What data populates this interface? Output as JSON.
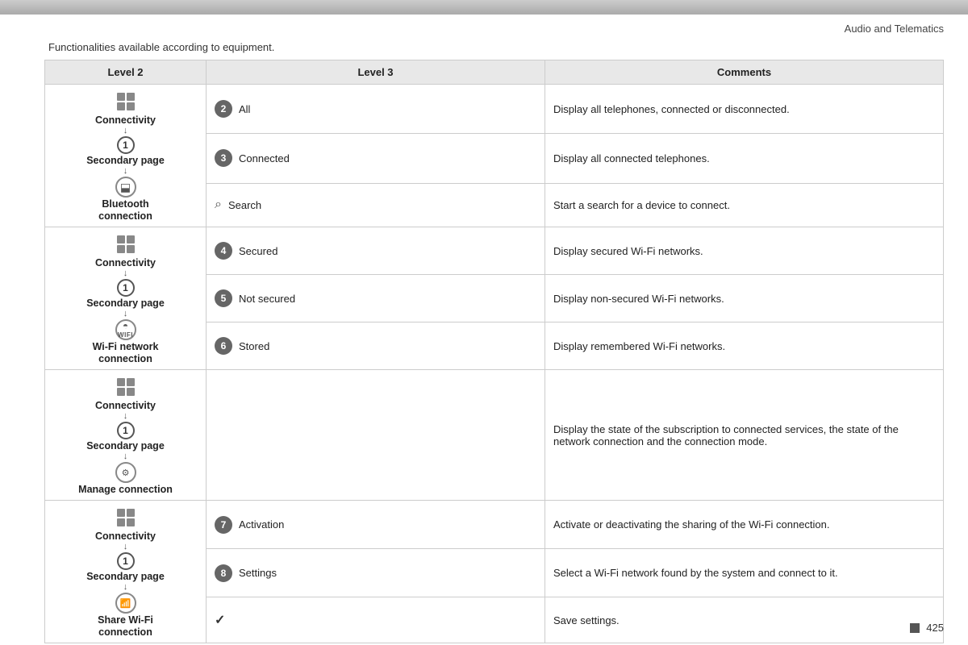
{
  "page": {
    "header": "Audio and Telematics",
    "intro": "Functionalities available according to equipment.",
    "footer_page": "425"
  },
  "table": {
    "headers": [
      "Level 2",
      "Level 3",
      "Comments"
    ],
    "sections": [
      {
        "id": "bluetooth",
        "level2_lines": [
          "Connectivity",
          "↓",
          "Secondary page",
          "↓",
          "Bluetooth",
          "connection"
        ],
        "level2_icon": "grid",
        "level2_badge": "1",
        "level2_sub_icon": "bluetooth",
        "rows": [
          {
            "badge": "2",
            "badge_type": "filled",
            "level3_text": "All",
            "comment": "Display all telephones, connected or disconnected."
          },
          {
            "badge": "3",
            "badge_type": "filled",
            "level3_text": "Connected",
            "comment": "Display all connected telephones."
          },
          {
            "badge": "search",
            "badge_type": "search",
            "level3_text": "Search",
            "comment": "Start a search for a device to connect."
          }
        ]
      },
      {
        "id": "wifi-network",
        "level2_lines": [
          "Connectivity",
          "↓",
          "Secondary page",
          "↓",
          "Wi-Fi network",
          "connection"
        ],
        "level2_icon": "grid",
        "level2_badge": "1",
        "level2_sub_icon": "wifi",
        "rows": [
          {
            "badge": "4",
            "badge_type": "filled",
            "level3_text": "Secured",
            "comment": "Display secured Wi-Fi networks."
          },
          {
            "badge": "5",
            "badge_type": "filled",
            "level3_text": "Not secured",
            "comment": "Display non-secured Wi-Fi networks."
          },
          {
            "badge": "6",
            "badge_type": "filled",
            "level3_text": "Stored",
            "comment": "Display remembered Wi-Fi networks."
          }
        ]
      },
      {
        "id": "manage",
        "level2_lines": [
          "Connectivity",
          "↓",
          "Secondary page",
          "↓",
          "Manage connection"
        ],
        "level2_icon": "grid",
        "level2_badge": "1",
        "level2_sub_icon": "manage",
        "rows": [
          {
            "badge": "",
            "badge_type": "none",
            "level3_text": "",
            "comment": "Display the state of the subscription to connected services, the state of the network connection and the connection mode."
          }
        ]
      },
      {
        "id": "share-wifi",
        "level2_lines": [
          "Connectivity",
          "↓",
          "Secondary page",
          "↓",
          "Share Wi-Fi",
          "connection"
        ],
        "level2_icon": "grid",
        "level2_badge": "1",
        "level2_sub_icon": "share",
        "rows": [
          {
            "badge": "7",
            "badge_type": "filled",
            "level3_text": "Activation",
            "comment": "Activate or deactivating the sharing of the Wi-Fi connection."
          },
          {
            "badge": "8",
            "badge_type": "filled",
            "level3_text": "Settings",
            "comment": "Select a Wi-Fi network found by the system and connect to it."
          },
          {
            "badge": "check",
            "badge_type": "check",
            "level3_text": "",
            "comment": "Save settings."
          }
        ]
      }
    ]
  }
}
